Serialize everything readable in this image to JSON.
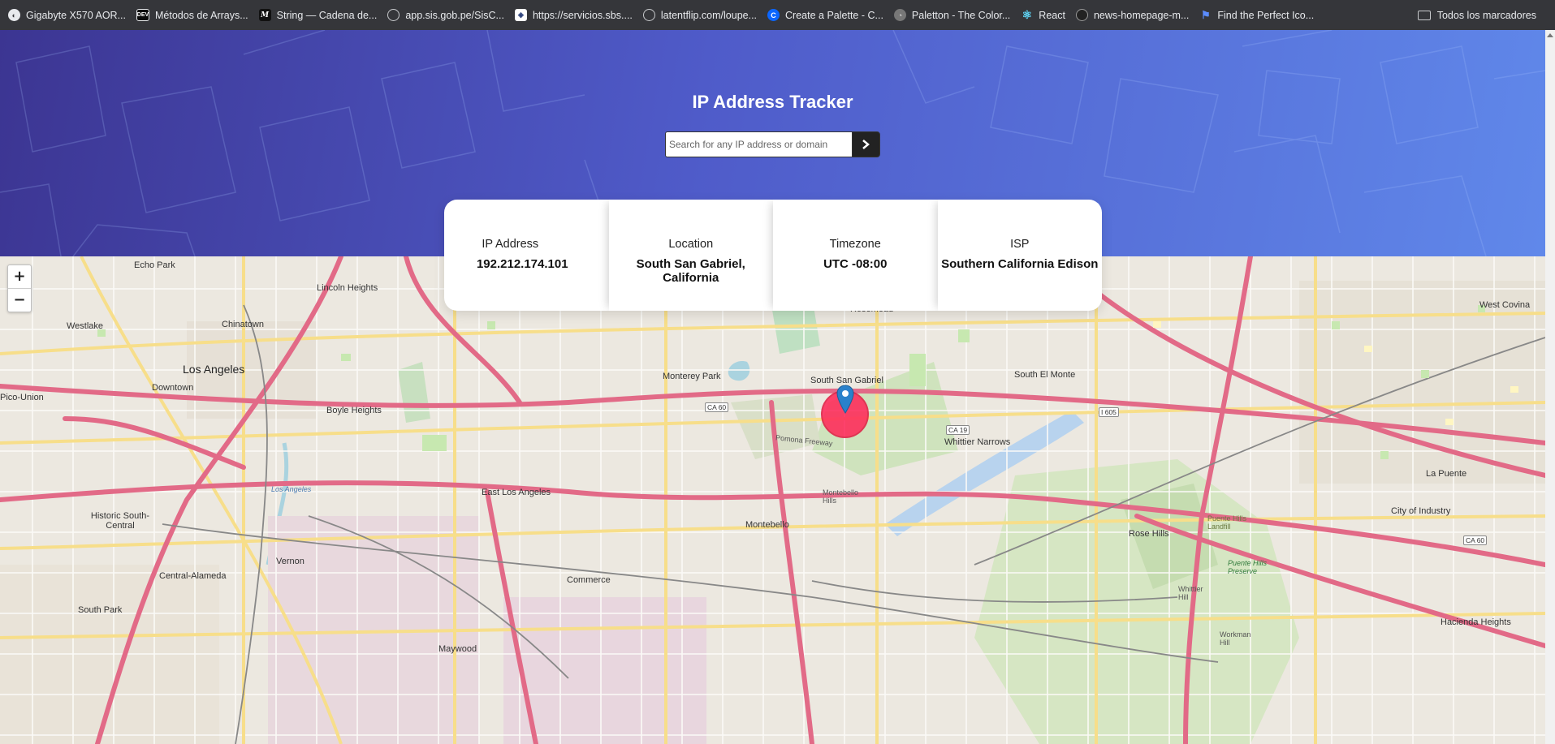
{
  "bookmarks": {
    "items": [
      {
        "label": "Gigabyte X570 AOR...",
        "icon": "circle-favicon-icon"
      },
      {
        "label": "Métodos de Arrays...",
        "icon": "dev-favicon-icon"
      },
      {
        "label": "String — Cadena de...",
        "icon": "mdn-favicon-icon"
      },
      {
        "label": "app.sis.gob.pe/SisC...",
        "icon": "globe-icon"
      },
      {
        "label": "https://servicios.sbs....",
        "icon": "sbs-favicon-icon"
      },
      {
        "label": "latentflip.com/loupe...",
        "icon": "globe-icon"
      },
      {
        "label": "Create a Palette - C...",
        "icon": "coolors-favicon-icon"
      },
      {
        "label": "Paletton - The Color...",
        "icon": "paletton-favicon-icon"
      },
      {
        "label": "React",
        "icon": "react-icon"
      },
      {
        "label": "news-homepage-m...",
        "icon": "github-icon"
      },
      {
        "label": "Find the Perfect Ico...",
        "icon": "flag-icon"
      }
    ],
    "all_label": "Todos los marcadores"
  },
  "header": {
    "title": "IP Address Tracker",
    "search_placeholder": "Search for any IP address or domain"
  },
  "info": {
    "ip": {
      "label": "IP Address",
      "value": "192.212.174.101"
    },
    "location": {
      "label": "Location",
      "value": "South San Gabriel, California"
    },
    "timezone": {
      "label": "Timezone",
      "value": "UTC -08:00"
    },
    "isp": {
      "label": "ISP",
      "value": "Southern California Edison"
    }
  },
  "map": {
    "zoom_in": "+",
    "zoom_out": "−",
    "labels": {
      "echo_park": "Echo Park",
      "lincoln_heights": "Lincoln Heights",
      "westlake": "Westlake",
      "chinatown": "Chinatown",
      "los_angeles": "Los Angeles",
      "downtown": "Downtown",
      "pico_union": "Pico-Union",
      "boyle_heights": "Boyle Heights",
      "rosemead": "Rosemead",
      "monterey_park": "Monterey Park",
      "south_san_gabriel": "South San Gabriel",
      "south_el_monte": "South El Monte",
      "west_covina": "West Covina",
      "whittier_narrows": "Whittier Narrows",
      "east_los_angeles": "East Los Angeles",
      "historic_south_central": "Historic South-Central",
      "montebello": "Montebello",
      "montebello_hills": "Montebello Hills",
      "la_puente": "La Puente",
      "city_of_industry": "City of Industry",
      "rose_hills": "Rose Hills",
      "vernon": "Vernon",
      "central_alameda": "Central-Alameda",
      "commerce": "Commerce",
      "south_park": "South Park",
      "maywood": "Maywood",
      "hacienda_heights": "Hacienda Heights",
      "pomona_freeway": "Pomona Freeway",
      "los_angeles_river": "Los Angeles",
      "puente_hills_landfill": "Puente Hills Landfill",
      "puente_hills_preserve": "Puente Hills Preserve",
      "whittier_hill": "Whittier Hill",
      "workman_hill": "Workman Hill"
    },
    "shields": {
      "ca60_a": "CA 60",
      "ca60_b": "CA 60",
      "ca19": "CA 19",
      "i605": "I 605"
    }
  },
  "colors": {
    "hero_start": "#3c3592",
    "hero_end": "#6088ea",
    "marker_fill": "#ff2a5a",
    "pin_blue": "#2a81cb"
  }
}
